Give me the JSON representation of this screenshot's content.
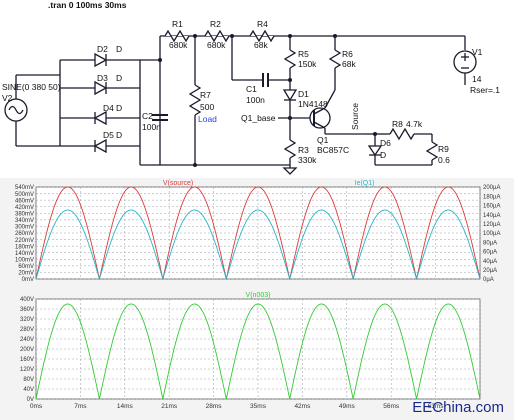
{
  "schematic": {
    "directive": ".tran 0 100ms 30ms",
    "components": {
      "R1": {
        "name": "R1",
        "value": "680k"
      },
      "R2": {
        "name": "R2",
        "value": "680k"
      },
      "R4": {
        "name": "R4",
        "value": "68k"
      },
      "R5": {
        "name": "R5",
        "value": "150k"
      },
      "R6": {
        "name": "R6",
        "value": "68k"
      },
      "R7": {
        "name": "R7",
        "value": "500",
        "extra": "Load"
      },
      "R3": {
        "name": "R3",
        "value": "330k"
      },
      "R8": {
        "name": "R8",
        "value": "4.7k"
      },
      "R9": {
        "name": "R9",
        "value": "0.6"
      },
      "C1": {
        "name": "C1",
        "value": "100n"
      },
      "C2": {
        "name": "C2",
        "value": "100n"
      },
      "D1": {
        "name": "D1",
        "value": "1N4148"
      },
      "D2": {
        "name": "D2",
        "value": "D"
      },
      "D3": {
        "name": "D3",
        "value": "D"
      },
      "D4": {
        "name": "D4",
        "value": "D"
      },
      "D5": {
        "name": "D5",
        "value": "D"
      },
      "D6": {
        "name": "D6",
        "value": "D"
      },
      "Q1": {
        "name": "Q1",
        "value": "BC857C"
      },
      "V1": {
        "name": "V1",
        "value": "14",
        "extra": "Rser=.1"
      },
      "V2": {
        "name": "V2",
        "value": "SINE(0 380 50)"
      }
    },
    "nets": {
      "q1_base": "Q1_base",
      "source": "Source"
    }
  },
  "plots": {
    "top": {
      "traces": [
        {
          "label": "V(source)",
          "color": "#e03a3a"
        },
        {
          "label": "Ie(Q1)",
          "color": "#29b5c8"
        }
      ],
      "left_ticks": [
        "540mV",
        "500mV",
        "460mV",
        "420mV",
        "380mV",
        "340mV",
        "300mV",
        "260mV",
        "220mV",
        "180mV",
        "140mV",
        "100mV",
        "60mV",
        "20mV",
        "0mV"
      ],
      "right_ticks": [
        "200µA",
        "180µA",
        "160µA",
        "140µA",
        "120µA",
        "100µA",
        "80µA",
        "60µA",
        "40µA",
        "20µA",
        "0µA"
      ]
    },
    "bottom": {
      "traces": [
        {
          "label": "V(n003)",
          "color": "#33cc33"
        }
      ],
      "left_ticks": [
        "400V",
        "360V",
        "320V",
        "280V",
        "240V",
        "200V",
        "160V",
        "120V",
        "80V",
        "40V",
        "0V"
      ],
      "x_ticks": [
        "0ms",
        "7ms",
        "14ms",
        "21ms",
        "28ms",
        "35ms",
        "42ms",
        "49ms",
        "56ms",
        "63ms"
      ]
    },
    "grid_color": "#9aa0a6"
  },
  "chart_data": [
    {
      "type": "line",
      "title": "",
      "xlabel": "",
      "ylabel": "",
      "x_unit": "ms",
      "xlim": [
        0,
        70
      ],
      "ylim": [
        0,
        560
      ],
      "y2lim": [
        0,
        200
      ],
      "series": [
        {
          "name": "V(source)",
          "axis": "left",
          "unit": "mV",
          "shape": "abs-sine",
          "period_ms": 10,
          "peak": 560,
          "min": 0,
          "color": "#e03a3a"
        },
        {
          "name": "Ie(Q1)",
          "axis": "right",
          "unit": "µA",
          "shape": "abs-sine",
          "period_ms": 10,
          "peak": 150,
          "min": 0,
          "color": "#29b5c8"
        }
      ],
      "grid": true
    },
    {
      "type": "line",
      "title": "",
      "xlabel": "",
      "ylabel": "",
      "x_unit": "ms",
      "xlim": [
        0,
        70
      ],
      "ylim": [
        0,
        400
      ],
      "series": [
        {
          "name": "V(n003)",
          "unit": "V",
          "shape": "abs-sine",
          "period_ms": 10,
          "peak": 380,
          "min": 0,
          "color": "#33cc33"
        }
      ],
      "grid": true
    }
  ],
  "watermark": "EEChina.com"
}
